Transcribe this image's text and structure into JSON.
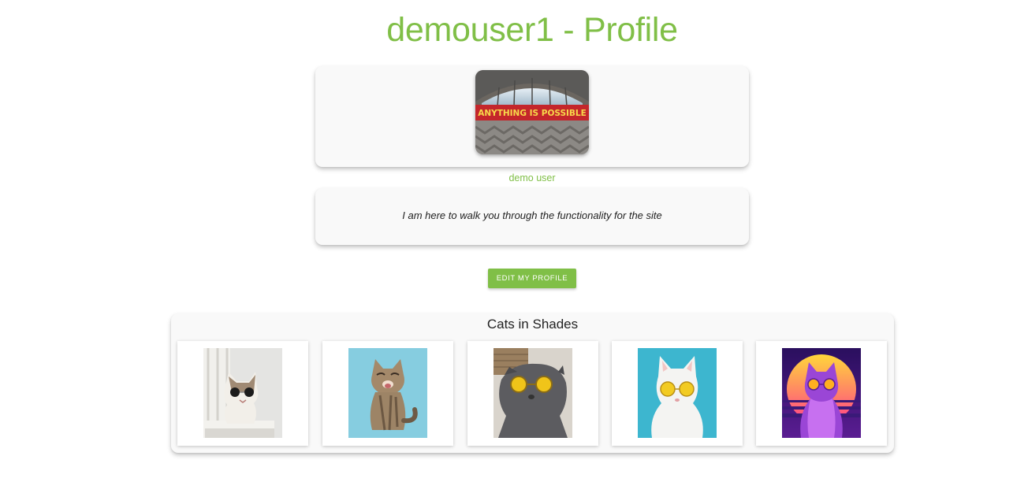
{
  "page": {
    "title": "demouser1 - Profile",
    "accent_color": "#80bf47"
  },
  "profile": {
    "avatar_sign_text": "ANYTHING IS POSSIBLE",
    "display_name": "demo user",
    "bio": "I am here to walk you through the functionality for the site"
  },
  "actions": {
    "edit_label": "EDIT MY PROFILE"
  },
  "gallery": {
    "title": "Cats in Shades",
    "items": [
      {
        "icon": "cat-with-sunglasses-on-chair-image"
      },
      {
        "icon": "kitten-on-blue-background-image"
      },
      {
        "icon": "grey-cat-with-yellow-sunglasses-image"
      },
      {
        "icon": "white-cat-with-yellow-sunglasses-image"
      },
      {
        "icon": "synthwave-cat-with-sunglasses-image"
      }
    ]
  }
}
